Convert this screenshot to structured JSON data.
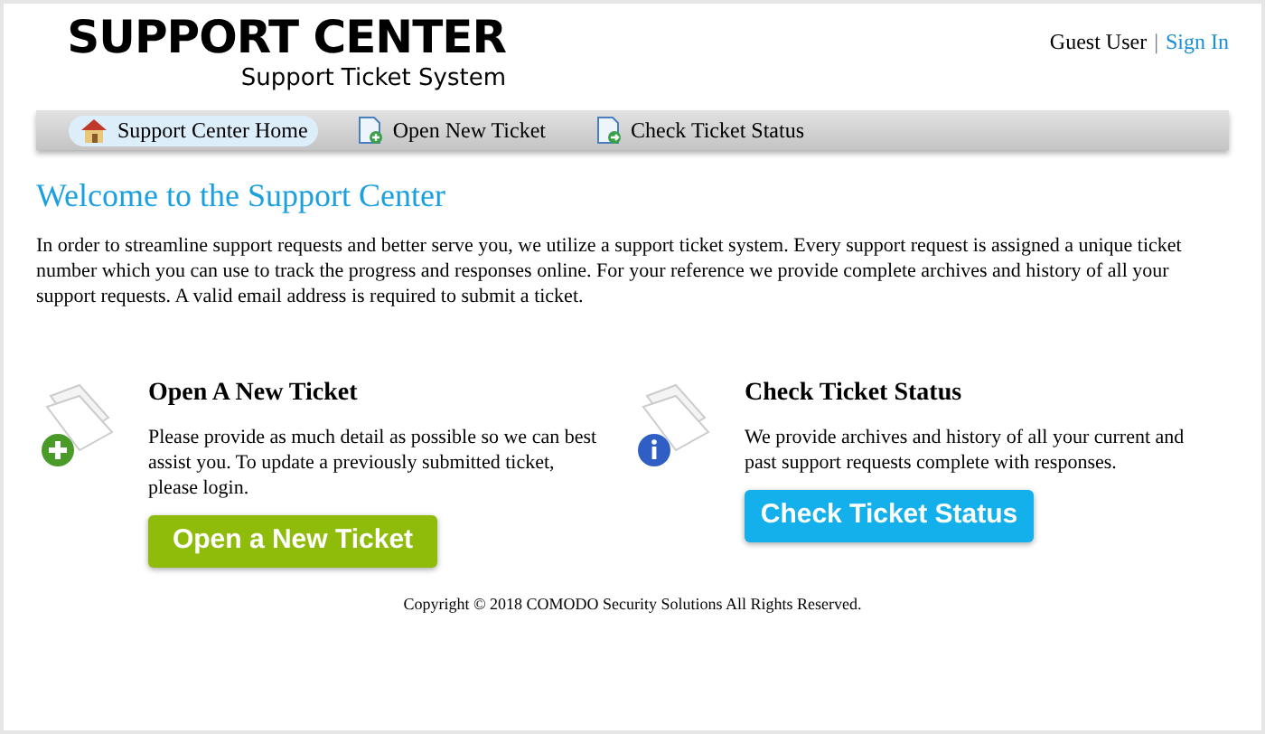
{
  "logo": {
    "title": "SUPPORT CENTER",
    "subtitle": "Support Ticket System"
  },
  "user": {
    "name": "Guest User",
    "separator": "|",
    "sign_in": "Sign In"
  },
  "nav": [
    {
      "label": "Support Center Home",
      "kind": "home",
      "selected": true
    },
    {
      "label": "Open New Ticket",
      "kind": "new",
      "selected": false
    },
    {
      "label": "Check Ticket Status",
      "kind": "status",
      "selected": false
    }
  ],
  "welcome": {
    "heading": "Welcome to the Support Center",
    "text": "In order to streamline support requests and better serve you, we utilize a support ticket system. Every support request is assigned a unique ticket number which you can use to track the progress and responses online. For your reference we provide complete archives and history of all your support requests. A valid email address is required to submit a ticket."
  },
  "cards": [
    {
      "kind": "new",
      "title": "Open A New Ticket",
      "text": "Please provide as much detail as possible so we can best assist you. To update a previously submitted ticket, please login.",
      "button": "Open a New Ticket"
    },
    {
      "kind": "status",
      "title": "Check Ticket Status",
      "text": "We provide archives and history of all your current and past support requests complete with responses.",
      "button": "Check Ticket Status"
    }
  ],
  "footer": "Copyright © 2018 COMODO Security Solutions All Rights Reserved."
}
